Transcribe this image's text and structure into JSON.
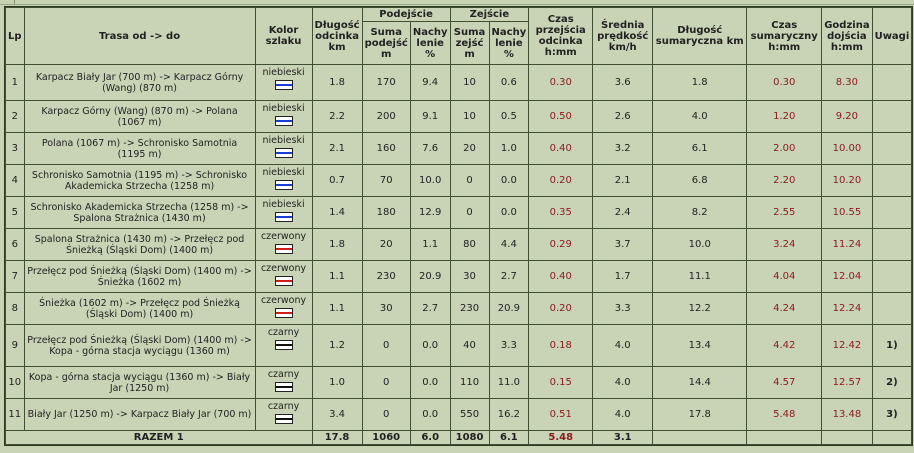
{
  "headers": {
    "lp": "Lp",
    "trasa": "Trasa od -> do",
    "kolor": "Kolor szlaku",
    "dlugosc": "Długość odcinka km",
    "podejscie": "Podejście",
    "zejscie": "Zejście",
    "suma_podejsc": "Suma podejść m",
    "nachylenie": "Nachy lenie %",
    "suma_zejsc": "Suma zejść m",
    "nachylenie2": "Nachy lenie %",
    "czas": "Czas przejścia odcinka h:mm",
    "srednia": "Średnia prędkość km/h",
    "dlugosc_sum": "Długość sumaryczna km",
    "czas_sum": "Czas sumaryczny h:mm",
    "godzina": "Godzina dojścia h:mm",
    "uwagi": "Uwagi"
  },
  "colors": {
    "niebieski": "#1a3fd0",
    "czerwony": "#d01a1a",
    "czarny": "#111111"
  },
  "rows": [
    {
      "lp": "1",
      "trasa": "Karpacz Biały Jar (700 m) -> Karpacz Górny (Wang) (870 m)",
      "kolor": "niebieski",
      "dl": "1.8",
      "pod": "170",
      "nach_p": "9.4",
      "zej": "10",
      "nach_z": "0.6",
      "czas": "0.30",
      "sr": "3.6",
      "dl_sum": "1.8",
      "czas_sum": "0.30",
      "godz": "8.30",
      "uwagi": ""
    },
    {
      "lp": "2",
      "trasa": "Karpacz Górny (Wang) (870 m) -> Polana (1067 m)",
      "kolor": "niebieski",
      "dl": "2.2",
      "pod": "200",
      "nach_p": "9.1",
      "zej": "10",
      "nach_z": "0.5",
      "czas": "0.50",
      "sr": "2.6",
      "dl_sum": "4.0",
      "czas_sum": "1.20",
      "godz": "9.20",
      "uwagi": ""
    },
    {
      "lp": "3",
      "trasa": "Polana (1067 m) -> Schronisko Samotnia (1195 m)",
      "kolor": "niebieski",
      "dl": "2.1",
      "pod": "160",
      "nach_p": "7.6",
      "zej": "20",
      "nach_z": "1.0",
      "czas": "0.40",
      "sr": "3.2",
      "dl_sum": "6.1",
      "czas_sum": "2.00",
      "godz": "10.00",
      "uwagi": ""
    },
    {
      "lp": "4",
      "trasa": "Schronisko Samotnia (1195 m) -> Schronisko Akademicka Strzecha (1258 m)",
      "kolor": "niebieski",
      "dl": "0.7",
      "pod": "70",
      "nach_p": "10.0",
      "zej": "0",
      "nach_z": "0.0",
      "czas": "0.20",
      "sr": "2.1",
      "dl_sum": "6.8",
      "czas_sum": "2.20",
      "godz": "10.20",
      "uwagi": ""
    },
    {
      "lp": "5",
      "trasa": "Schronisko Akademicka Strzecha (1258 m) -> Spalona Strażnica (1430 m)",
      "kolor": "niebieski",
      "dl": "1.4",
      "pod": "180",
      "nach_p": "12.9",
      "zej": "0",
      "nach_z": "0.0",
      "czas": "0.35",
      "sr": "2.4",
      "dl_sum": "8.2",
      "czas_sum": "2.55",
      "godz": "10.55",
      "uwagi": ""
    },
    {
      "lp": "6",
      "trasa": "Spalona Strażnica (1430 m) -> Przełęcz pod Śnieżką (Śląski Dom) (1400 m)",
      "kolor": "czerwony",
      "dl": "1.8",
      "pod": "20",
      "nach_p": "1.1",
      "zej": "80",
      "nach_z": "4.4",
      "czas": "0.29",
      "sr": "3.7",
      "dl_sum": "10.0",
      "czas_sum": "3.24",
      "godz": "11.24",
      "uwagi": ""
    },
    {
      "lp": "7",
      "trasa": "Przełęcz pod Śnieżką (Śląski Dom) (1400 m) -> Śnieżka (1602 m)",
      "kolor": "czerwony",
      "dl": "1.1",
      "pod": "230",
      "nach_p": "20.9",
      "zej": "30",
      "nach_z": "2.7",
      "czas": "0.40",
      "sr": "1.7",
      "dl_sum": "11.1",
      "czas_sum": "4.04",
      "godz": "12.04",
      "uwagi": ""
    },
    {
      "lp": "8",
      "trasa": "Śnieżka (1602 m) -> Przełęcz pod Śnieżką (Śląski Dom) (1400 m)",
      "kolor": "czerwony",
      "dl": "1.1",
      "pod": "30",
      "nach_p": "2.7",
      "zej": "230",
      "nach_z": "20.9",
      "czas": "0.20",
      "sr": "3.3",
      "dl_sum": "12.2",
      "czas_sum": "4.24",
      "godz": "12.24",
      "uwagi": ""
    },
    {
      "lp": "9",
      "trasa": "Przełęcz pod Śnieżką (Śląski Dom) (1400 m) -> Kopa - górna stacja wyciągu (1360 m)",
      "kolor": "czarny",
      "dl": "1.2",
      "pod": "0",
      "nach_p": "0.0",
      "zej": "40",
      "nach_z": "3.3",
      "czas": "0.18",
      "sr": "4.0",
      "dl_sum": "13.4",
      "czas_sum": "4.42",
      "godz": "12.42",
      "uwagi": "1)"
    },
    {
      "lp": "10",
      "trasa": "Kopa - górna stacja wyciągu (1360 m) -> Biały Jar (1250 m)",
      "kolor": "czarny",
      "dl": "1.0",
      "pod": "0",
      "nach_p": "0.0",
      "zej": "110",
      "nach_z": "11.0",
      "czas": "0.15",
      "sr": "4.0",
      "dl_sum": "14.4",
      "czas_sum": "4.57",
      "godz": "12.57",
      "uwagi": "2)"
    },
    {
      "lp": "11",
      "trasa": "Biały Jar (1250 m) -> Karpacz Biały Jar (700 m)",
      "kolor": "czarny",
      "dl": "3.4",
      "pod": "0",
      "nach_p": "0.0",
      "zej": "550",
      "nach_z": "16.2",
      "czas": "0.51",
      "sr": "4.0",
      "dl_sum": "17.8",
      "czas_sum": "5.48",
      "godz": "13.48",
      "uwagi": "3)"
    }
  ],
  "total": {
    "label": "RAZEM 1",
    "dl": "17.8",
    "pod": "1060",
    "nach_p": "6.0",
    "zej": "1080",
    "nach_z": "6.1",
    "czas": "5.48",
    "sr": "3.1"
  }
}
